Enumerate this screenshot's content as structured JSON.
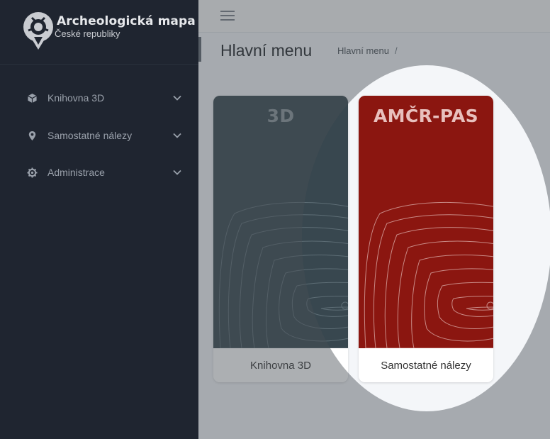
{
  "brand": {
    "title": "Archeologická mapa",
    "subtitle": "České republiky"
  },
  "sidebar": {
    "items": [
      {
        "label": "Knihovna 3D",
        "icon": "cube-icon"
      },
      {
        "label": "Samostatné nálezy",
        "icon": "map-pin-icon"
      },
      {
        "label": "Administrace",
        "icon": "gear-icon"
      }
    ]
  },
  "header": {
    "title": "Hlavní menu"
  },
  "breadcrumb": {
    "current": "Hlavní menu",
    "separator": "/"
  },
  "cards": [
    {
      "heading": "3D",
      "label": "Knihovna 3D",
      "color": "#38474f"
    },
    {
      "heading": "AMČR-PAS",
      "label": "Samostatné nálezy",
      "color": "#8b1610"
    }
  ],
  "colors": {
    "sidebar": "#1f2530",
    "accent_red": "#8b1610",
    "card_slate": "#38474f"
  }
}
